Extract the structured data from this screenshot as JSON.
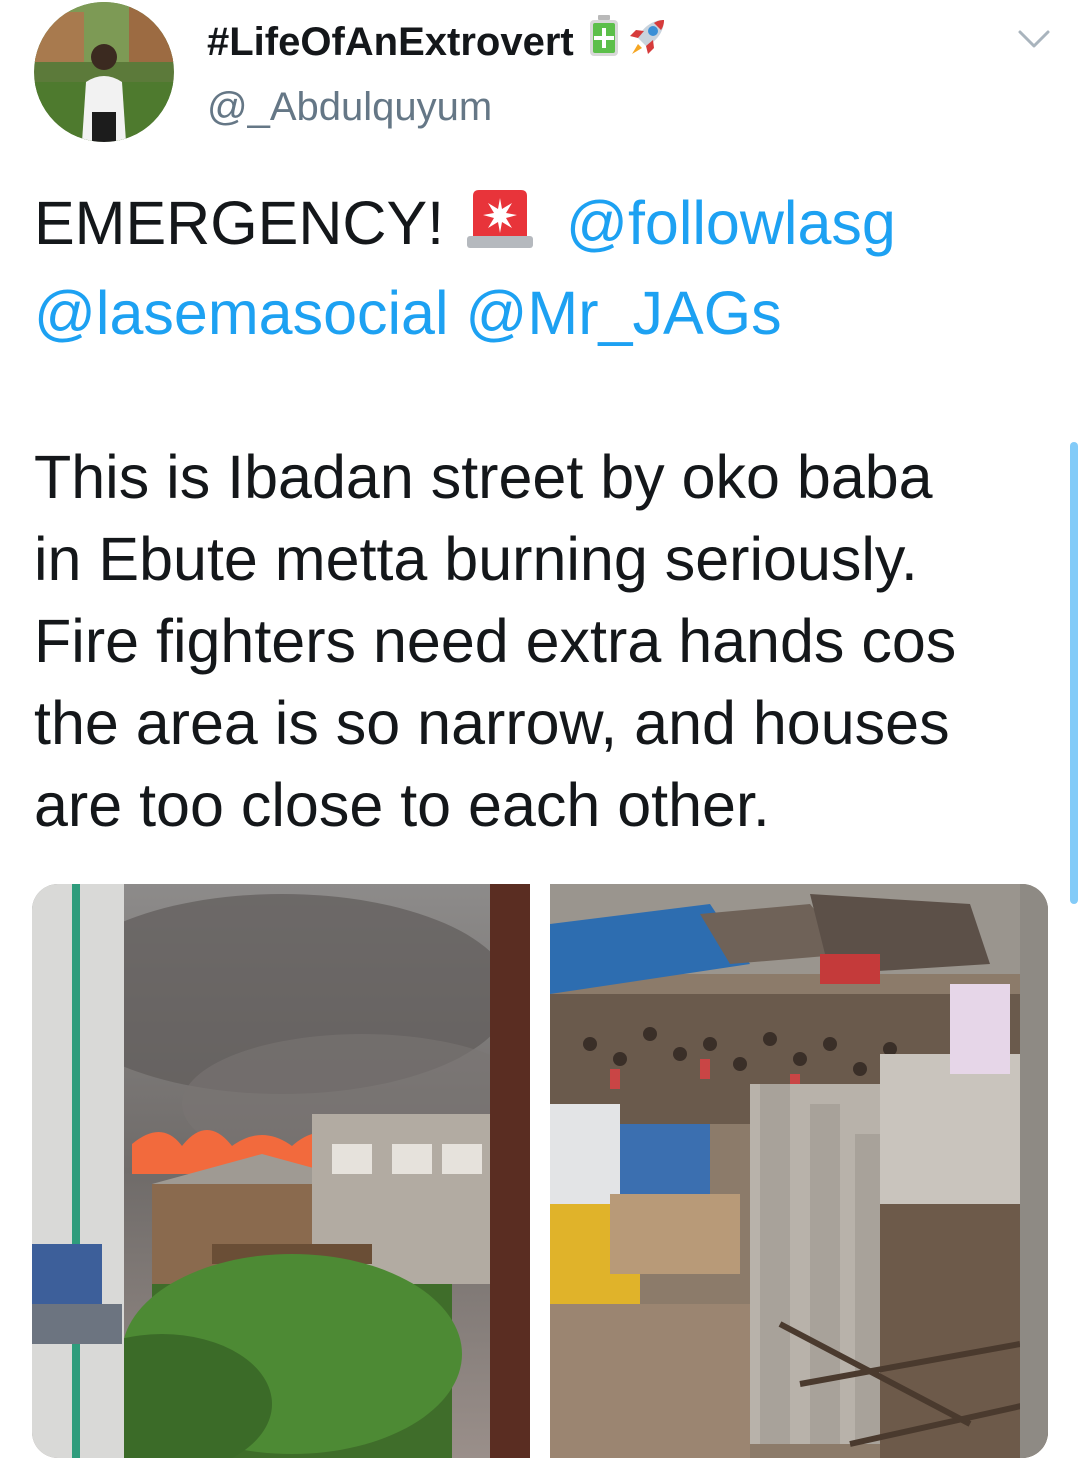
{
  "tweet": {
    "display_name": "#LifeOfAnExtrovert",
    "handle": "@_Abdulquyum",
    "display_name_emojis": [
      "battery-icon",
      "rocket-icon"
    ],
    "text": {
      "emergency": "EMERGENCY!",
      "emergency_emoji": "siren-icon",
      "mention_1": "@followlasg",
      "mention_2": "@lasemasocial",
      "mention_3": "@Mr_JAGs",
      "line_1": "This is Ibadan street by oko baba",
      "line_2": "in Ebute metta burning seriously.",
      "line_3": "Fire fighters need extra hands cos",
      "line_4": "the area is so narrow, and houses",
      "line_5": "are too close to each other."
    },
    "media": [
      {
        "name": "fire-photo"
      },
      {
        "name": "street-crowd-photo"
      }
    ]
  },
  "colors": {
    "mention": "#1da1f2",
    "text": "#14171a",
    "secondary": "#657786"
  }
}
